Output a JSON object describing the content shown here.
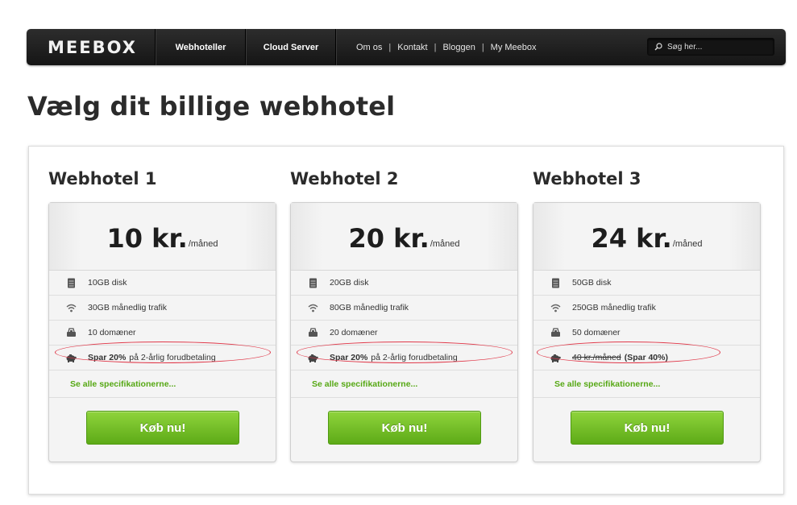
{
  "nav": {
    "logo": "MEEBOX",
    "webhoteller": "Webhoteller",
    "cloud_server": "Cloud Server",
    "links": [
      "Om os",
      "Kontakt",
      "Bloggen",
      "My Meebox"
    ],
    "separator": "|",
    "search_placeholder": "Søg her..."
  },
  "page_title": "Vælg dit billige webhotel",
  "plans": [
    {
      "name": "Webhotel 1",
      "price": "10 kr.",
      "unit": "/måned",
      "features": [
        "10GB disk",
        "30GB månedlig trafik",
        "10 domæner"
      ],
      "offer_bold": "Spar 20%",
      "offer_rest": "på 2-årlig forudbetaling",
      "spec_link": "Se alle specifikationerne...",
      "buy_label": "Køb nu!"
    },
    {
      "name": "Webhotel 2",
      "price": "20 kr.",
      "unit": "/måned",
      "features": [
        "20GB disk",
        "80GB månedlig trafik",
        "20 domæner"
      ],
      "offer_bold": "Spar 20%",
      "offer_rest": "på 2-årlig forudbetaling",
      "spec_link": "Se alle specifikationerne...",
      "buy_label": "Køb nu!"
    },
    {
      "name": "Webhotel 3",
      "price": "24 kr.",
      "unit": "/måned",
      "features": [
        "50GB disk",
        "250GB månedlig trafik",
        "50 domæner"
      ],
      "offer_strike": "40 kr./måned",
      "offer_bold": "(Spar 40%)",
      "spec_link": "Se alle specifikationerne...",
      "buy_label": "Køb nu!"
    }
  ],
  "colors": {
    "accent_green": "#5daa17",
    "link_green": "#56a814",
    "highlight_red": "#e0394a",
    "nav_bg": "#1e1e1e"
  },
  "icons": [
    "disk-icon",
    "wifi-icon",
    "domain-icon",
    "piggy-bank-icon",
    "search-icon"
  ]
}
